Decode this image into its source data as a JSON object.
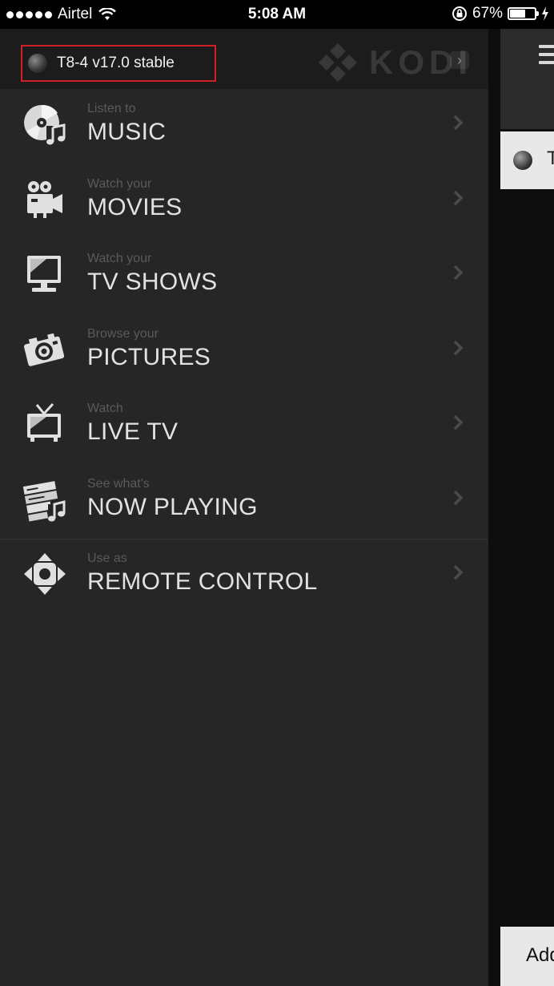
{
  "status_bar": {
    "carrier": "Airtel",
    "time": "5:08 AM",
    "battery_percent": "67%",
    "battery_level": 0.67
  },
  "host": {
    "name": "T8-4 v17.0 stable",
    "highlight_color": "#d21f2a"
  },
  "logo": {
    "text": "KODI"
  },
  "menu": {
    "items": [
      {
        "subtitle": "Listen to",
        "title": "MUSIC",
        "icon": "music-disc-icon"
      },
      {
        "subtitle": "Watch your",
        "title": "MOVIES",
        "icon": "movie-camera-icon"
      },
      {
        "subtitle": "Watch your",
        "title": "TV SHOWS",
        "icon": "monitor-icon"
      },
      {
        "subtitle": "Browse your",
        "title": "PICTURES",
        "icon": "photo-camera-icon"
      },
      {
        "subtitle": "Watch",
        "title": "LIVE TV",
        "icon": "tv-antenna-icon"
      },
      {
        "subtitle": "See what's",
        "title": "NOW PLAYING",
        "icon": "now-playing-icon"
      },
      {
        "subtitle": "Use as",
        "title": "REMOTE CONTROL",
        "icon": "remote-dpad-icon"
      }
    ]
  },
  "background_panel": {
    "host_peek": "T",
    "bottom_peek": "Add"
  }
}
